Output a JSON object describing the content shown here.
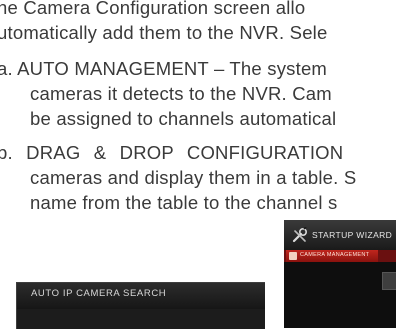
{
  "document": {
    "lines": [
      "he Camera Configuration screen allo",
      "utomatically add them to the NVR. Sele",
      "a.  AUTO MANAGEMENT – The system",
      "cameras it detects to the NVR. Cam",
      "be assigned to channels automatical",
      "b.  DRAG & DROP CONFIGURATION",
      "cameras and display them in a table. S",
      "name from the table to the channel s"
    ]
  },
  "screenshot_left": {
    "title": "AUTO IP CAMERA SEARCH"
  },
  "screenshot_right": {
    "header_title": "STARTUP WIZARD",
    "tab_label": "CAMERA MANAGEMENT",
    "icon": "wizard-tools-icon"
  },
  "colors": {
    "text": "#3a3a3a",
    "screenshot_bg": "#1c1c1c",
    "tab_red": "#c0261e"
  }
}
